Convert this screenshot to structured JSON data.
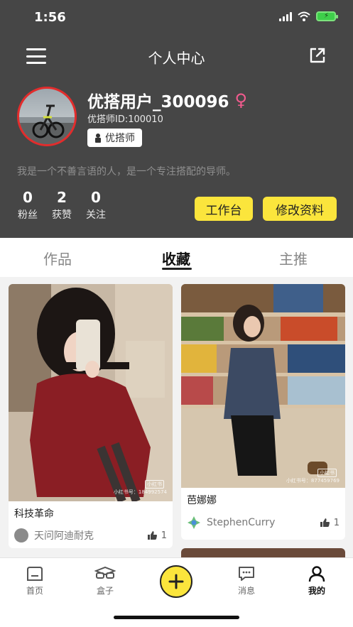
{
  "status": {
    "time": "1:56"
  },
  "nav": {
    "title": "个人中心"
  },
  "profile": {
    "username": "优搭用户_300096",
    "gender_symbol": "♀",
    "user_id": "优搭师ID:100010",
    "role": "优搭师",
    "bio": "我是一个不善言语的人，是一个专注搭配的导师。"
  },
  "stats": [
    {
      "value": "0",
      "label": "粉丝"
    },
    {
      "value": "2",
      "label": "获赞"
    },
    {
      "value": "0",
      "label": "关注"
    }
  ],
  "actions": {
    "workbench": "工作台",
    "edit_profile": "修改资料"
  },
  "tabs": [
    {
      "label": "作品"
    },
    {
      "label": "收藏"
    },
    {
      "label": "主推"
    }
  ],
  "active_tab": "收藏",
  "posts": [
    {
      "title": "科技革命",
      "author": "天问阿迪耐克",
      "likes": "1",
      "watermark": "小红书号：184992574",
      "stamp": "小红书"
    },
    {
      "title": "芭娜娜",
      "author": "StephenCurry",
      "likes": "1",
      "watermark": "小红书号：877459769",
      "stamp": "小红书"
    }
  ],
  "tabbar": [
    {
      "label": "首页",
      "icon": "home-icon"
    },
    {
      "label": "盒子",
      "icon": "glasses-icon"
    },
    {
      "label": "消息",
      "icon": "message-icon"
    },
    {
      "label": "我的",
      "icon": "person-icon"
    }
  ],
  "colors": {
    "header_bg": "#464646",
    "accent": "#fbe53c",
    "gender": "#f15b8e",
    "avatar_border": "#e22c2c"
  }
}
